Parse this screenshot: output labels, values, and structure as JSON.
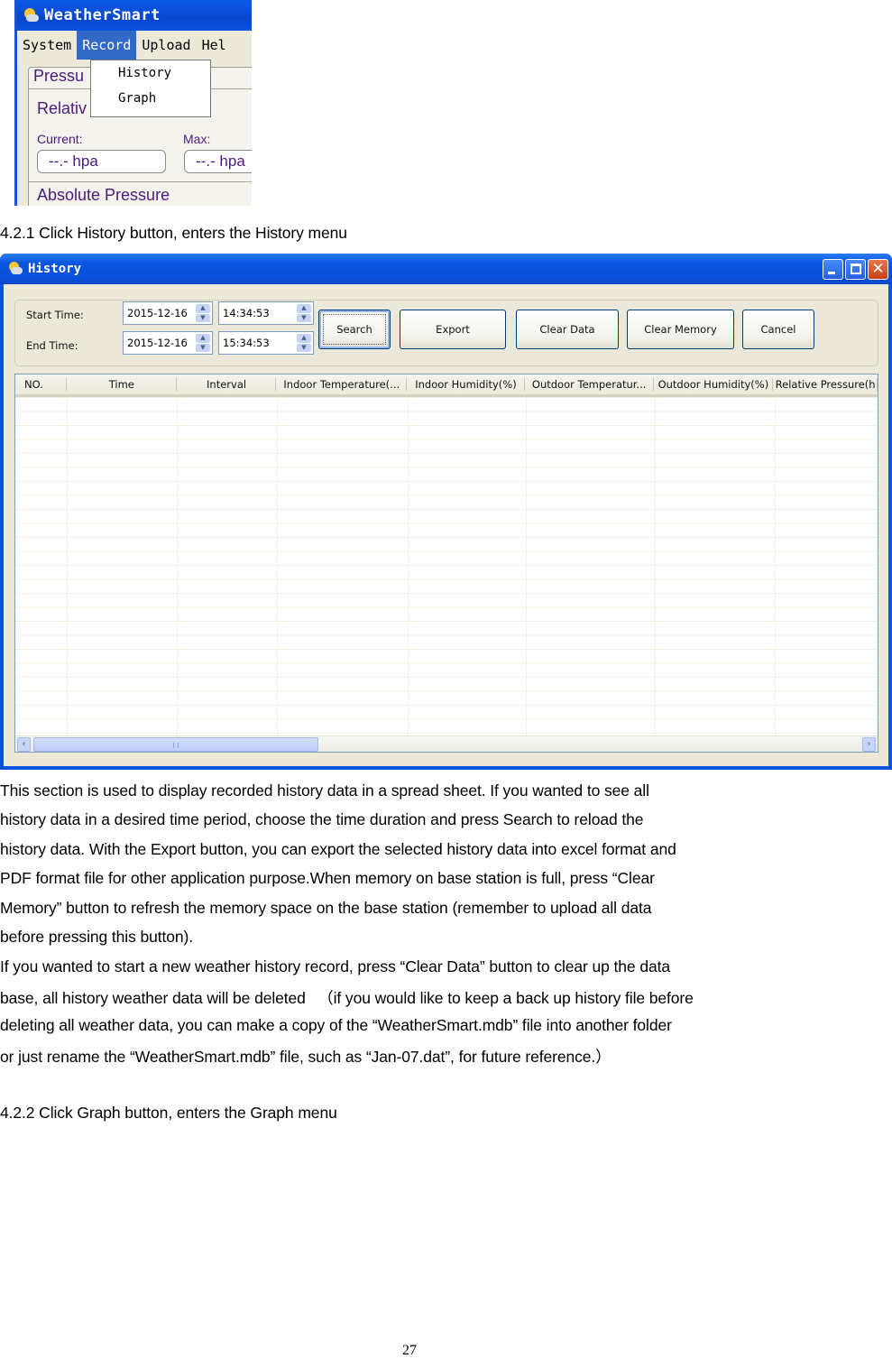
{
  "weathersmart": {
    "title": "WeatherSmart",
    "menu": [
      "System",
      "Record",
      "Upload",
      "Hel"
    ],
    "active_menu": "Record",
    "dropdown": [
      "History",
      "Graph"
    ],
    "panel": {
      "tab": "Pressu",
      "section": "Relativ",
      "current_label": "Current:",
      "max_label": "Max:",
      "current_value": "--.- hpa",
      "max_value": "--.- hpa",
      "section2": "Absolute Pressure"
    }
  },
  "heading1": "4.2.1 Click History button, enters the History menu",
  "history_window": {
    "title": "History",
    "window_buttons": [
      "minimize",
      "maximize",
      "close"
    ],
    "start_label": "Start Time:",
    "end_label": "End Time:",
    "start_date": "2015-12-16",
    "start_time": "14:34:53",
    "end_date": "2015-12-16",
    "end_time": "15:34:53",
    "buttons": {
      "search": "Search",
      "export": "Export",
      "clear_data": "Clear Data",
      "clear_memory": "Clear Memory",
      "cancel": "Cancel"
    },
    "columns": [
      "NO.",
      "Time",
      "Interval",
      "Indoor Temperature(...",
      "Indoor Humidity(%)",
      "Outdoor Temperatur...",
      "Outdoor Humidity(%)",
      "Relative Pressure(h"
    ],
    "rows": []
  },
  "paragraphs": [
    "This section is used to display recorded history data in a spread sheet. If you wanted to see all",
    "history data in a desired time period, choose the time duration and press Search to reload the",
    "history data. With the Export button, you can export the selected history data into excel format and",
    "PDF format file for other application purpose.When memory on base station is full, press “Clear",
    "Memory” button to refresh the memory space on the base station (remember to upload all data",
    "before pressing this button).",
    "If you wanted to start a new weather history record, press “Clear Data” button to clear up the data",
    "base, all history weather data will be deleted 　（if you would like to keep a back up history file before",
    "deleting all weather data, you can make a copy of the “WeatherSmart.mdb” file into another folder",
    "or just rename the “WeatherSmart.mdb” file, such as “Jan-07.dat”, for future reference.）"
  ],
  "heading2": "4.2.2 Click Graph button, enters the Graph menu",
  "page_number": "27"
}
